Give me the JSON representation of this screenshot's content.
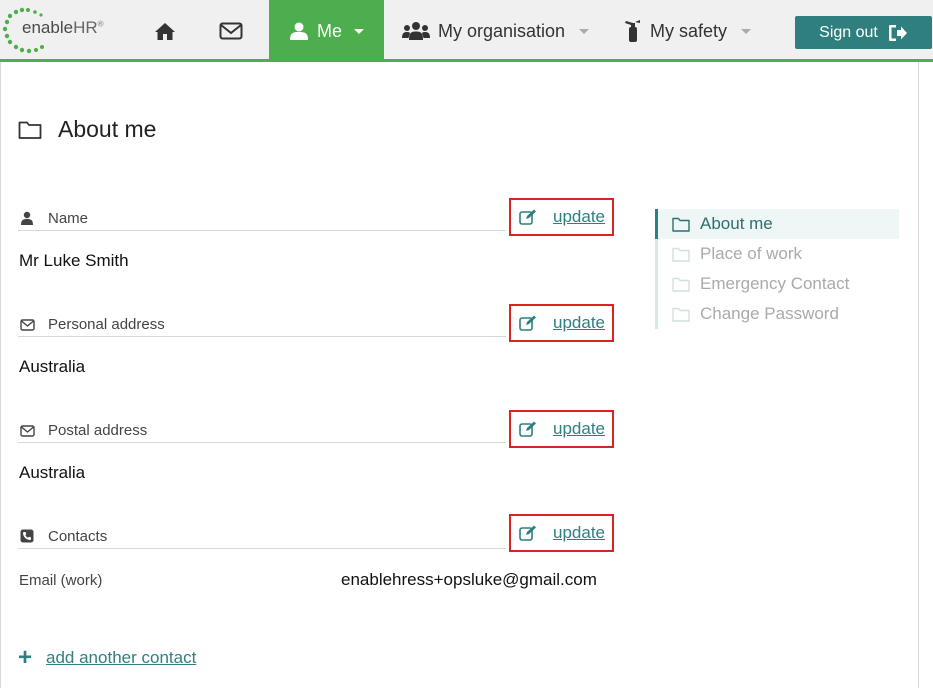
{
  "brand": {
    "name_main": "enable",
    "name_suffix": "HR",
    "mark": "®"
  },
  "nav": {
    "me_label": "Me",
    "org_label": "My organisation",
    "safety_label": "My safety",
    "signout_label": "Sign out"
  },
  "page": {
    "title": "About me"
  },
  "sections": {
    "name": {
      "label": "Name",
      "value": "Mr Luke Smith",
      "action": "update"
    },
    "personal_address": {
      "label": "Personal address",
      "value": "Australia",
      "action": "update"
    },
    "postal_address": {
      "label": "Postal address",
      "value": "Australia",
      "action": "update"
    },
    "contacts": {
      "label": "Contacts",
      "action": "update",
      "rows": [
        {
          "type": "Email (work)",
          "value": "enablehress+opsluke@gmail.com"
        }
      ],
      "add_label": "add another contact"
    }
  },
  "sidenav": {
    "items": [
      {
        "label": "About me",
        "active": true
      },
      {
        "label": "Place of work",
        "active": false
      },
      {
        "label": "Emergency Contact",
        "active": false
      },
      {
        "label": "Change Password",
        "active": false
      }
    ]
  },
  "colors": {
    "accent_green": "#4cae4c",
    "accent_teal": "#2f7f7f",
    "highlight_red": "#dd2222"
  }
}
